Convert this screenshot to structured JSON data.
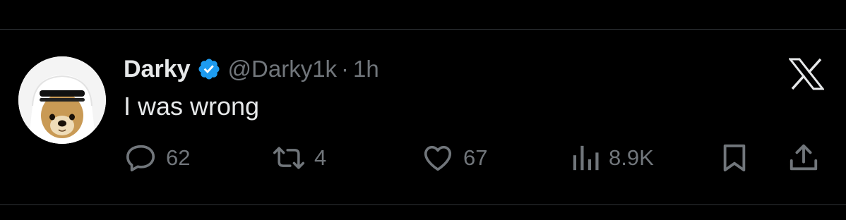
{
  "tweet": {
    "display_name": "Darky",
    "handle": "@Darky1k",
    "separator": "·",
    "time": "1h",
    "text": "I was wrong"
  },
  "actions": {
    "replies": "62",
    "retweets": "4",
    "likes": "67",
    "views": "8.9K"
  },
  "colors": {
    "background": "#000000",
    "primary_text": "#e7e9ea",
    "secondary_text": "#71767b",
    "verified_badge": "#1d9bf0",
    "divider": "#2f3336"
  },
  "icons": {
    "verified": "verified-badge-icon",
    "platform": "x-logo-icon",
    "reply": "reply-icon",
    "retweet": "retweet-icon",
    "like": "heart-icon",
    "views": "views-icon",
    "bookmark": "bookmark-icon",
    "share": "share-icon"
  }
}
